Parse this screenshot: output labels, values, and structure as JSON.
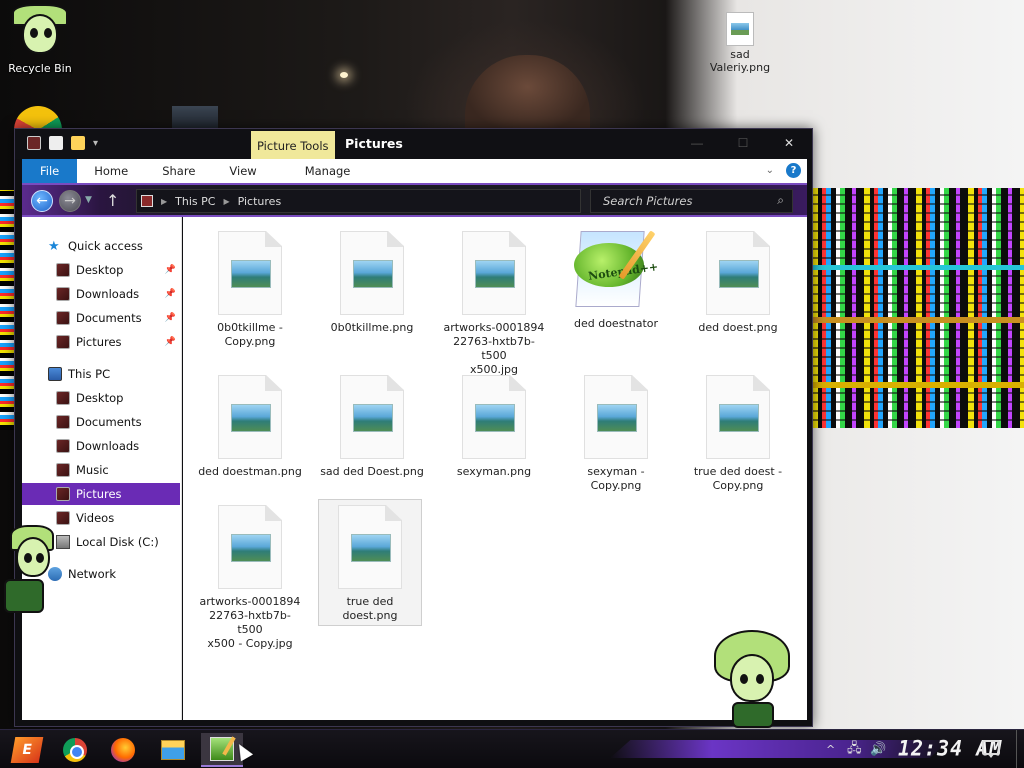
{
  "desktop": {
    "icons": [
      {
        "label": "Recycle Bin",
        "icon": "recycle-bin-icon"
      },
      {
        "label": "sad Valeriy.png",
        "icon": "png-file-icon"
      }
    ]
  },
  "window": {
    "contextual_tab": "Picture Tools",
    "title": "Pictures",
    "controls": {
      "minimize": "—",
      "maximize": "☐",
      "close": "✕"
    },
    "ribbon_tabs": [
      "File",
      "Home",
      "Share",
      "View",
      "Manage"
    ],
    "address_path": [
      "This PC",
      "Pictures"
    ],
    "search_placeholder": "Search Pictures"
  },
  "nav_pane": {
    "quick_access": {
      "label": "Quick access",
      "items": [
        "Desktop",
        "Downloads",
        "Documents",
        "Pictures"
      ]
    },
    "this_pc": {
      "label": "This PC",
      "items": [
        "Desktop",
        "Documents",
        "Downloads",
        "Music",
        "Pictures",
        "Videos",
        "Local Disk (C:)"
      ]
    },
    "network": "Network",
    "selected": "Pictures"
  },
  "files": [
    {
      "name": "0b0tkillme - Copy.png",
      "type": "image"
    },
    {
      "name": "0b0tkillme.png",
      "type": "image"
    },
    {
      "name": "artworks-000189422763-hxtb7b-t500x500.jpg",
      "type": "image"
    },
    {
      "name": "ded doestnator",
      "type": "notepad++"
    },
    {
      "name": "ded doest.png",
      "type": "image"
    },
    {
      "name": "ded doestman.png",
      "type": "image"
    },
    {
      "name": "sad ded Doest.png",
      "type": "image"
    },
    {
      "name": "sexyman.png",
      "type": "image"
    },
    {
      "name": "sexyman - Copy.png",
      "type": "image"
    },
    {
      "name": "true ded doest - Copy.png",
      "type": "image"
    },
    {
      "name": "artworks-000189422763-hxtb7b-t500x500 - Copy.jpg",
      "type": "image"
    },
    {
      "name": "true ded doest.png",
      "type": "image",
      "selected": true
    }
  ],
  "file_labels": {
    "f1": "0b0tkillme -\nCopy.png",
    "f2": "0b0tkillme.png",
    "f3": "artworks-0001894\n22763-hxtb7b-t500\nx500.jpg",
    "f4": "ded doestnator",
    "f5": "ded doest.png",
    "f6": "ded doestman.png",
    "f7": "sad ded Doest.png",
    "f8": "sexyman.png",
    "f9": "sexyman -\nCopy.png",
    "f10": "true ded doest -\nCopy.png",
    "f11": "artworks-0001894\n22763-hxtb7b-t500\nx500 - Copy.jpg",
    "f12": "true ded doest.png"
  },
  "notepad_icon_text": "Notepad++",
  "taskbar": {
    "apps": [
      "start-menu-icon",
      "chrome-icon",
      "firefox-icon",
      "file-explorer-icon",
      "notepad-plus-plus-icon"
    ],
    "active_app": "notepad-plus-plus-icon",
    "start_label": "E",
    "clock": "12:34 AM"
  },
  "colors": {
    "accent_purple": "#6a2bb5",
    "file_tab_blue": "#1979ca",
    "picture_tools_yellow": "#f0e89a"
  }
}
